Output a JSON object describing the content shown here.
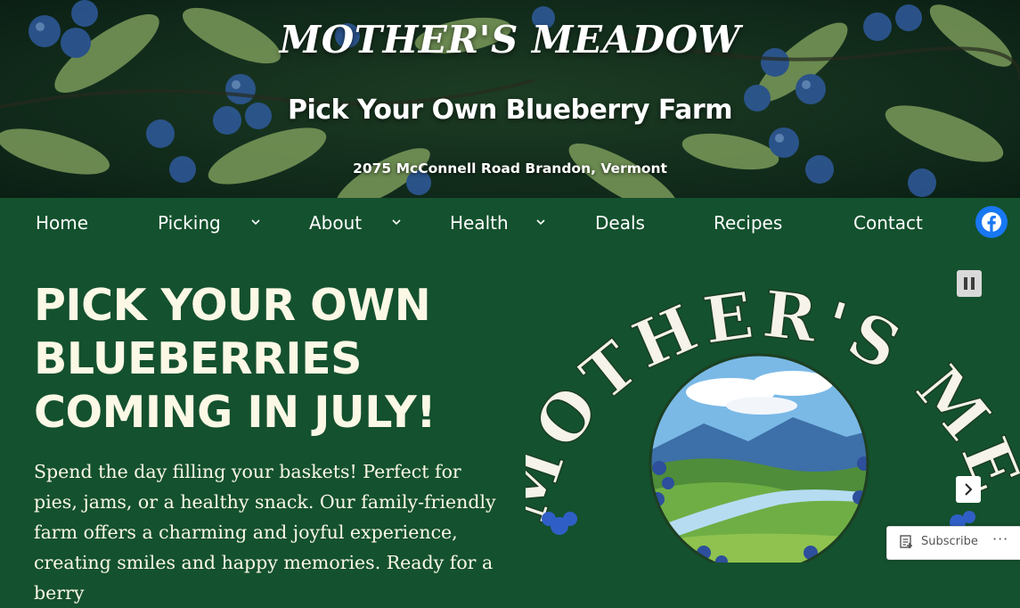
{
  "header": {
    "site_title": "MOTHER'S MEADOW",
    "tagline": "Pick Your Own Blueberry Farm",
    "address": "2075 McConnell Road Brandon, Vermont"
  },
  "nav": {
    "items": [
      {
        "label": "Home",
        "has_submenu": false
      },
      {
        "label": "Picking",
        "has_submenu": true
      },
      {
        "label": "About",
        "has_submenu": true
      },
      {
        "label": "Health",
        "has_submenu": true
      },
      {
        "label": "Deals",
        "has_submenu": false
      },
      {
        "label": "Recipes",
        "has_submenu": false
      },
      {
        "label": "Contact",
        "has_submenu": false
      }
    ],
    "social_icon": "facebook-icon"
  },
  "main": {
    "headline": "PICK YOUR OWN BLUEBERRIES COMING IN JULY!",
    "intro": "Spend the day filling your baskets! Perfect for pies, jams, or a healthy snack. Our family-friendly farm offers a charming and joyful experience, creating smiles and happy memories. Ready for a berry"
  },
  "slideshow": {
    "logo_text": "MOTHER'S MEADOW",
    "pause_icon": "pause-icon",
    "next_icon": "chevron-right-icon"
  },
  "subscribe_bar": {
    "label": "Subscribe",
    "more_label": "···"
  },
  "colors": {
    "brand_green": "#14512e",
    "text_cream": "#fcf8e6",
    "facebook_blue": "#1877f2"
  }
}
